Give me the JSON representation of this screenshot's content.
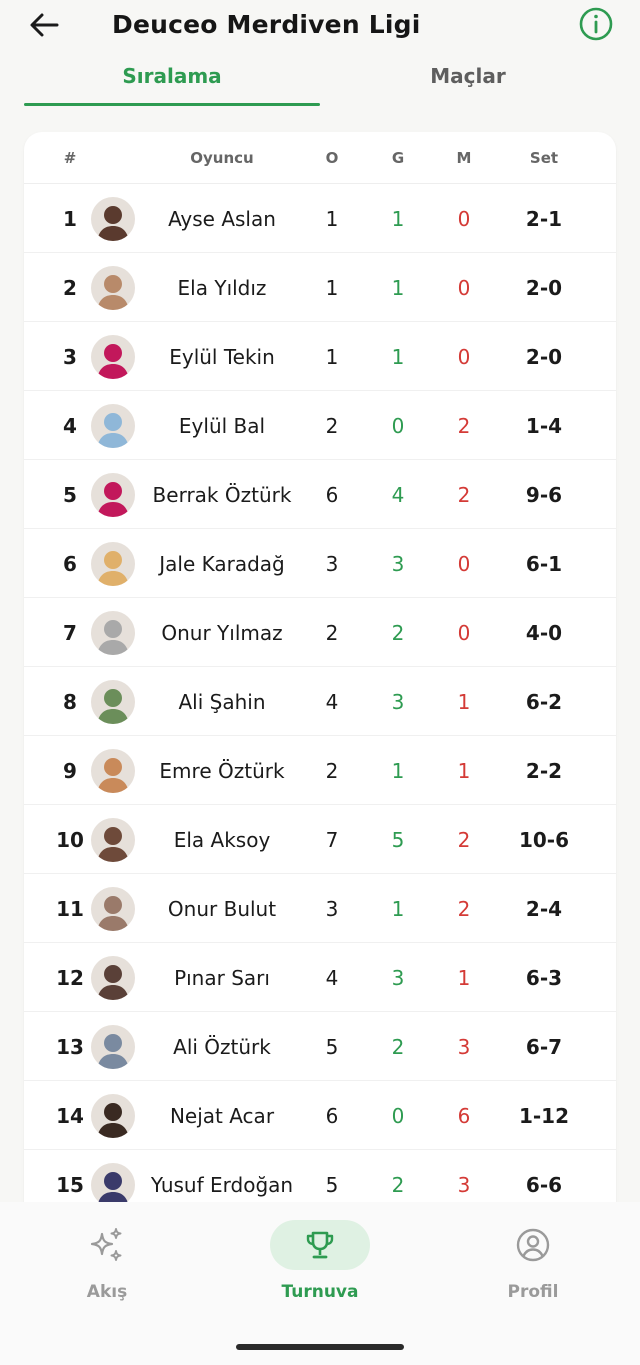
{
  "header": {
    "title": "Deuceo Merdiven Ligi",
    "back_icon": "arrow-left-icon",
    "info_icon": "info-circle-icon"
  },
  "tabs": [
    {
      "label": "Sıralama",
      "active": true
    },
    {
      "label": "Maçlar",
      "active": false
    }
  ],
  "table": {
    "headers": {
      "rank": "#",
      "player": "Oyuncu",
      "played": "O",
      "won": "G",
      "lost": "M",
      "set": "Set"
    },
    "rows": [
      {
        "rank": "1",
        "name": "Ayse Aslan",
        "played": "1",
        "won": "1",
        "lost": "0",
        "set": "2-1",
        "avatar_color": "#5a3a2e"
      },
      {
        "rank": "2",
        "name": "Ela Yıldız",
        "played": "1",
        "won": "1",
        "lost": "0",
        "set": "2-0",
        "avatar_color": "#b88a6a"
      },
      {
        "rank": "3",
        "name": "Eylül Tekin",
        "played": "1",
        "won": "1",
        "lost": "0",
        "set": "2-0",
        "avatar_color": "#c2185b"
      },
      {
        "rank": "4",
        "name": "Eylül Bal",
        "played": "2",
        "won": "0",
        "lost": "2",
        "set": "1-4",
        "avatar_color": "#8fb7d8"
      },
      {
        "rank": "5",
        "name": "Berrak Öztürk",
        "played": "6",
        "won": "4",
        "lost": "2",
        "set": "9-6",
        "avatar_color": "#c2185b"
      },
      {
        "rank": "6",
        "name": "Jale Karadağ",
        "played": "3",
        "won": "3",
        "lost": "0",
        "set": "6-1",
        "avatar_color": "#e0b06a"
      },
      {
        "rank": "7",
        "name": "Onur Yılmaz",
        "played": "2",
        "won": "2",
        "lost": "0",
        "set": "4-0",
        "avatar_color": "#a9a9a9"
      },
      {
        "rank": "8",
        "name": "Ali Şahin",
        "played": "4",
        "won": "3",
        "lost": "1",
        "set": "6-2",
        "avatar_color": "#6b8e5a"
      },
      {
        "rank": "9",
        "name": "Emre Öztürk",
        "played": "2",
        "won": "1",
        "lost": "1",
        "set": "2-2",
        "avatar_color": "#c98a5a"
      },
      {
        "rank": "10",
        "name": "Ela Aksoy",
        "played": "7",
        "won": "5",
        "lost": "2",
        "set": "10-6",
        "avatar_color": "#6e4a3a"
      },
      {
        "rank": "11",
        "name": "Onur Bulut",
        "played": "3",
        "won": "1",
        "lost": "2",
        "set": "2-4",
        "avatar_color": "#9a7a6a"
      },
      {
        "rank": "12",
        "name": "Pınar Sarı",
        "played": "4",
        "won": "3",
        "lost": "1",
        "set": "6-3",
        "avatar_color": "#5a4038"
      },
      {
        "rank": "13",
        "name": "Ali Öztürk",
        "played": "5",
        "won": "2",
        "lost": "3",
        "set": "6-7",
        "avatar_color": "#7a8aa0"
      },
      {
        "rank": "14",
        "name": "Nejat Acar",
        "played": "6",
        "won": "0",
        "lost": "6",
        "set": "1-12",
        "avatar_color": "#3a2a22"
      },
      {
        "rank": "15",
        "name": "Yusuf Erdoğan",
        "played": "5",
        "won": "2",
        "lost": "3",
        "set": "6-6",
        "avatar_color": "#3a3a6a"
      }
    ]
  },
  "bottom_nav": [
    {
      "label": "Akış",
      "icon": "sparkles-icon",
      "active": false
    },
    {
      "label": "Turnuva",
      "icon": "trophy-icon",
      "active": true
    },
    {
      "label": "Profil",
      "icon": "user-circle-icon",
      "active": false
    }
  ],
  "colors": {
    "accent": "#2e9b51",
    "won": "#2e9b51",
    "lost": "#d43a36",
    "inactive": "#9a9a9a",
    "background": "#f7f7f5"
  }
}
